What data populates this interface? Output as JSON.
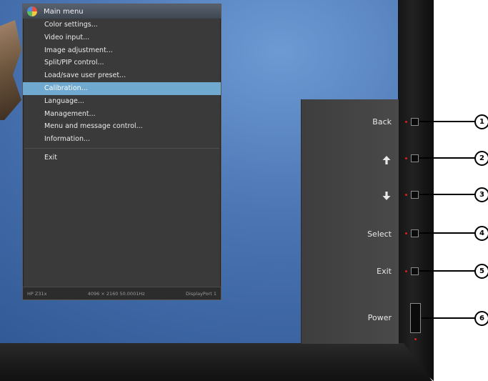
{
  "osd": {
    "title": "Main menu",
    "items": [
      {
        "label": "Color settings..."
      },
      {
        "label": "Video input..."
      },
      {
        "label": "Image adjustment..."
      },
      {
        "label": "Split/PIP control..."
      },
      {
        "label": "Load/save user preset..."
      },
      {
        "label": "Calibration...",
        "selected": true
      },
      {
        "label": "Language..."
      },
      {
        "label": "Management..."
      },
      {
        "label": "Menu and message control..."
      },
      {
        "label": "Information..."
      }
    ],
    "exit_label": "Exit",
    "footer": {
      "model": "HP Z31x",
      "resolution": "4096 × 2160  50.0001Hz",
      "input": "DisplayPort 1"
    }
  },
  "panel": {
    "back_label": "Back",
    "up_icon": "arrow-up-icon",
    "down_icon": "arrow-down-icon",
    "select_label": "Select",
    "exit_label": "Exit",
    "power_label": "Power"
  },
  "callouts": [
    "1",
    "2",
    "3",
    "4",
    "5",
    "6"
  ],
  "colors": {
    "selection": "#6fa9cf",
    "led": "#d81e1e"
  }
}
